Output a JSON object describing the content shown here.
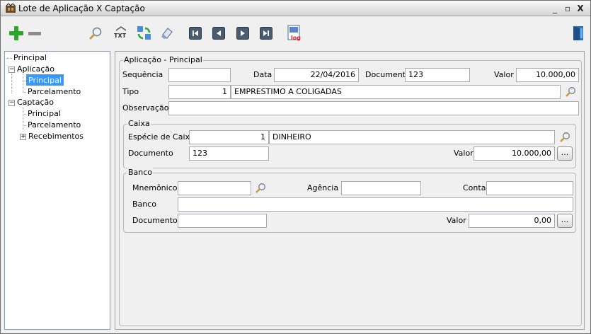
{
  "window": {
    "title": "Lote de Aplicação X Captação",
    "minimize": "_",
    "restore": "▫",
    "close": "X"
  },
  "toolbar": {
    "buttons": [
      "add-icon",
      "remove-icon",
      "search-icon",
      "txt-export-icon",
      "refresh-icon",
      "eraser-icon",
      "first-record-icon",
      "previous-record-icon",
      "next-record-icon",
      "last-record-icon",
      "log-icon",
      "exit-door-icon"
    ],
    "txt_label": "TXT",
    "log_label": "log"
  },
  "tree": {
    "principal": "Principal",
    "aplicacao": "Aplicação",
    "aplicacao_principal": "Principal",
    "aplicacao_parcelamento": "Parcelamento",
    "captacao": "Captação",
    "captacao_principal": "Principal",
    "captacao_parcelamento": "Parcelamento",
    "recebimentos": "Recebimentos",
    "expand_minus": "−",
    "expand_plus": "+"
  },
  "form": {
    "group_title": "Aplicação - Principal",
    "sequencia_label": "Sequência",
    "sequencia_value": "",
    "data_label": "Data",
    "data_value": "22/04/2016",
    "documento_label": "Documento",
    "documento_value": "123",
    "valor_label": "Valor",
    "valor_value": "10.000,00",
    "tipo_label": "Tipo",
    "tipo_code": "1",
    "tipo_desc": "EMPRESTIMO A COLIGADAS",
    "observacao_label": "Observação",
    "observacao_value": "",
    "caixa": {
      "title": "Caixa",
      "especie_label": "Espécie de Caixa",
      "especie_code": "1",
      "especie_desc": "DINHEIRO",
      "documento_label": "Documento",
      "documento_value": "123",
      "valor_label": "Valor",
      "valor_value": "10.000,00",
      "dots": "..."
    },
    "banco": {
      "title": "Banco",
      "mnemonico_label": "Mnemônico",
      "mnemonico_value": "",
      "agencia_label": "Agência",
      "agencia_value": "",
      "conta_label": "Conta",
      "conta_value": "",
      "banco_label": "Banco",
      "banco_value": "",
      "documento_label": "Documento",
      "documento_value": "",
      "valor_label": "Valor",
      "valor_value": "0,00",
      "dots": "..."
    }
  },
  "colors": {
    "selection": "#3399ff",
    "add_green": "#2ea62e",
    "nav_blue": "#34495e"
  }
}
